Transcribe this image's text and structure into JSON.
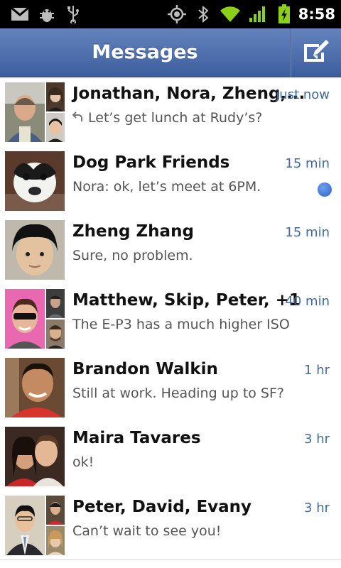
{
  "status_bar": {
    "time": "8:58",
    "icons": [
      "gmail-icon",
      "android-debug-icon",
      "usb-icon",
      "gps-icon",
      "bluetooth-icon",
      "wifi-icon",
      "signal-icon",
      "battery-charging-icon"
    ]
  },
  "header": {
    "title": "Messages",
    "compose_icon": "compose-icon"
  },
  "conversations": [
    {
      "name": "Jonathan, Nora, Zheng,...",
      "time": "just now",
      "snippet": "Let’s get lunch at Rudy’s?",
      "replied": true,
      "unread": false
    },
    {
      "name": "Dog Park Friends",
      "time": "15 min",
      "snippet": "Nora: ok, let’s meet at 6PM.",
      "replied": false,
      "unread": true
    },
    {
      "name": "Zheng Zhang",
      "time": "15 min",
      "snippet": "Sure, no problem.",
      "replied": false,
      "unread": false
    },
    {
      "name": "Matthew, Skip, Peter, +1",
      "time": "40 min",
      "snippet": "The E-P3 has a much higher ISO",
      "replied": false,
      "unread": false
    },
    {
      "name": "Brandon Walkin",
      "time": "1 hr",
      "snippet": "Still at work. Heading up to SF?",
      "replied": false,
      "unread": false
    },
    {
      "name": "Maira Tavares",
      "time": "3 hr",
      "snippet": "ok!",
      "replied": false,
      "unread": false
    },
    {
      "name": "Peter, David, Evany",
      "time": "3 hr",
      "snippet": "Can’t wait to see you!",
      "replied": false,
      "unread": false
    }
  ],
  "colors": {
    "header_top": "#6483bd",
    "header_bottom": "#3d5e9e",
    "time_text": "#44699c",
    "unread_dot": "#2f61c9"
  }
}
